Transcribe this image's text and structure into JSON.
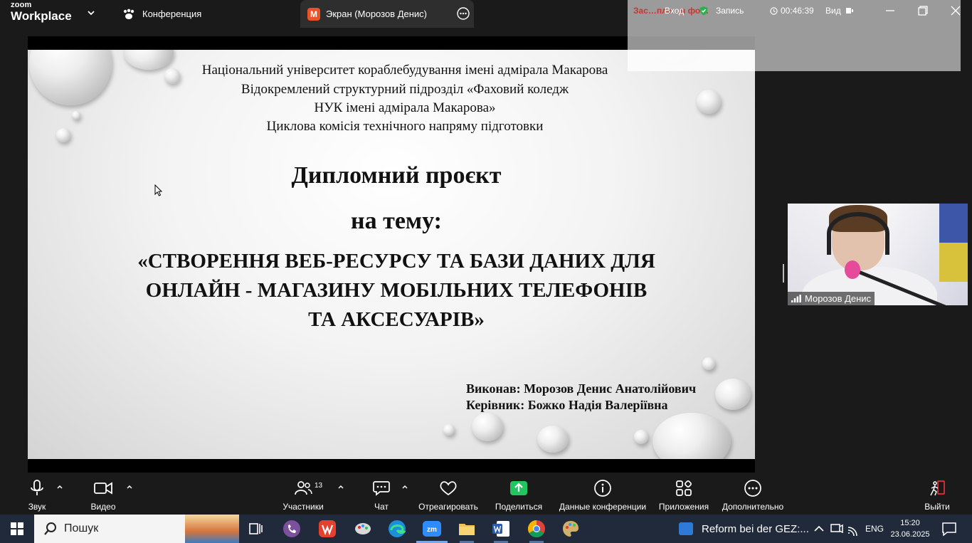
{
  "app": {
    "brand_top": "zoom",
    "brand_bottom": "Workplace"
  },
  "tabs": {
    "conference": "Конференция",
    "screen": "Экран (Морозов Денис)",
    "screen_badge": "M"
  },
  "overlay": {
    "login": "Вход",
    "record": "Запись",
    "timer": "00:46:39",
    "view": "Вид",
    "behind_text": "Зас…пле…я фо…"
  },
  "slide": {
    "header_lines": [
      "Національний університет кораблебудування  імені адмірала Макарова",
      "Відокремлений структурний підрозділ «Фаховий коледж",
      "НУК імені адмірала Макарова»",
      "Циклова комісія  технічного напряму підготовки"
    ],
    "title": "Дипломний проєкт",
    "subtitle": "на тему:",
    "theme_lines": [
      "«СТВОРЕННЯ ВЕБ-РЕСУРСУ ТА БАЗИ ДАНИХ ДЛЯ",
      "ОНЛАЙН - МАГАЗИНУ МОБІЛЬНИХ ТЕЛЕФОНІВ",
      "ТА АКСЕСУАРІВ»"
    ],
    "author": "Виконав: Морозов  Денис Анатолійович",
    "supervisor": "Керівник: Божко Надія Валеріївна"
  },
  "participant": {
    "name": "Морозов Денис"
  },
  "toolbar": {
    "audio": "Звук",
    "video": "Видео",
    "participants": "Участники",
    "participants_count": "13",
    "chat": "Чат",
    "react": "Отреагировать",
    "share": "Поделиться",
    "info": "Данные конференции",
    "apps": "Приложения",
    "more": "Дополнительно",
    "leave": "Выйти"
  },
  "taskbar": {
    "search_placeholder": "Пошук",
    "news": "Reform bei der GEZ:...",
    "lang": "ENG",
    "time": "15:20",
    "date": "23.06.2025"
  },
  "colors": {
    "share_green": "#22c55e",
    "leave_red": "#e0353b",
    "taskbar": "#202a3a"
  }
}
